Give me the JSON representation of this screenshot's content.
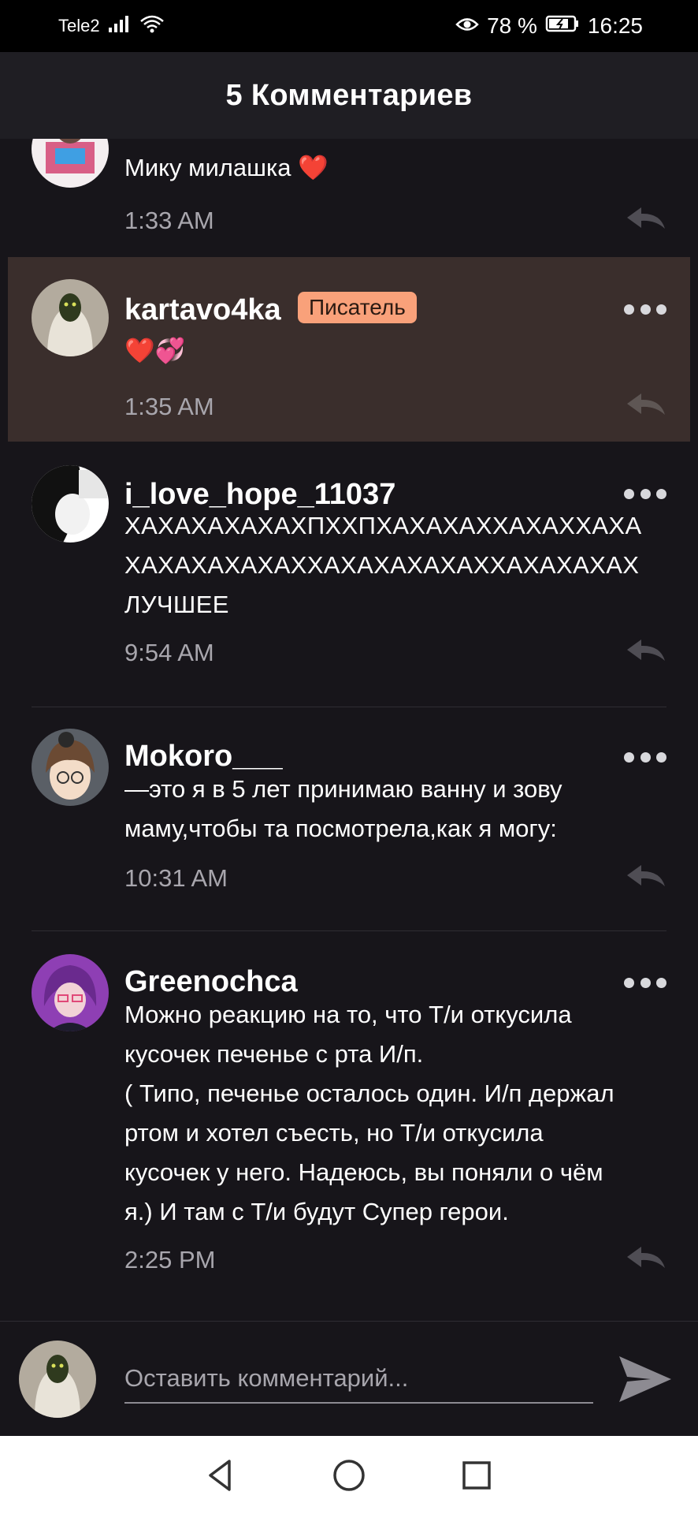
{
  "status_bar": {
    "carrier": "Tele2",
    "battery": "78 %",
    "time": "16:25"
  },
  "header": {
    "title": "5 Комментариев"
  },
  "comments": [
    {
      "username": "",
      "text": "Мику милашка ❤️",
      "time": "1:33 AM"
    },
    {
      "username": "kartavo4ka",
      "badge": "Писатель",
      "text": "❤️💞",
      "time": "1:35 AM"
    },
    {
      "username": "i_love_hope_11037",
      "text": "ХАХАХАХАХАХПХХПХАХАХАХХАХАХХАХА\nХАХАХАХАХАХХАХАХАХАХАХХАХАХАХАХ\nЛУЧШЕЕ",
      "time": "9:54 AM"
    },
    {
      "username": "Mokoro___",
      "text": "—это я в 5 лет принимаю ванну и зову\nмаму,чтобы та посмотрела,как я могу:",
      "time": "10:31 AM"
    },
    {
      "username": "Greenochca",
      "text": "Можно реакцию на то, что Т/и откусила\nкусочек печенье с рта И/п.\n( Типо, печенье осталось один. И/п держал\nртом и хотел съесть, но Т/и откусила\nкусочек у него. Надеюсь, вы поняли о чём\nя.) И там с Т/и будут Супер герои.",
      "time": "2:25 PM"
    }
  ],
  "input": {
    "placeholder": "Оставить комментарий..."
  },
  "colors": {
    "background": "#17151a",
    "highlight": "#3a2e2c",
    "badge": "#f9a17a",
    "muted_text": "#a8a6ad"
  },
  "icons": {
    "status": [
      "signal-icon",
      "wifi-icon",
      "eye-icon",
      "battery-icon"
    ],
    "actions": [
      "more-icon",
      "reply-icon",
      "send-icon"
    ],
    "nav": [
      "back-icon",
      "home-icon",
      "recents-icon"
    ]
  }
}
